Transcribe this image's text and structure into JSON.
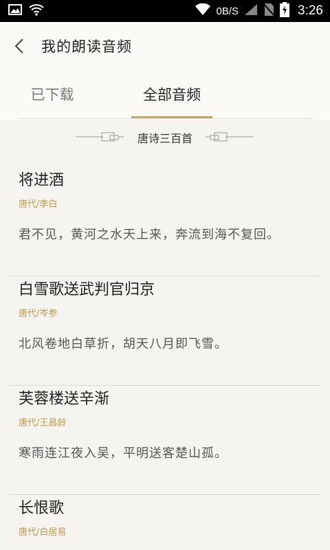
{
  "status_bar": {
    "net_speed": "0B/S",
    "time": "3:26"
  },
  "header": {
    "title": "我的朗读音频"
  },
  "tabs": [
    {
      "label": "已下载",
      "active": false
    },
    {
      "label": "全部音频",
      "active": true
    }
  ],
  "section": {
    "title": "唐诗三百首"
  },
  "poems": [
    {
      "title": "将进酒",
      "author": "唐代/李白",
      "line": "君不见，黄河之水天上来，奔流到海不复回。"
    },
    {
      "title": "白雪歌送武判官归京",
      "author": "唐代/岑参",
      "line": "北风卷地白草折，胡天八月即飞雪。"
    },
    {
      "title": "芙蓉楼送辛渐",
      "author": "唐代/王昌龄",
      "line": "寒雨连江夜入吴，平明送客楚山孤。"
    },
    {
      "title": "长恨歌",
      "author": "唐代/白居易",
      "line": ""
    }
  ],
  "colors": {
    "accent": "#c9a563",
    "author": "#c19a4a",
    "background": "#f5f4f1"
  }
}
